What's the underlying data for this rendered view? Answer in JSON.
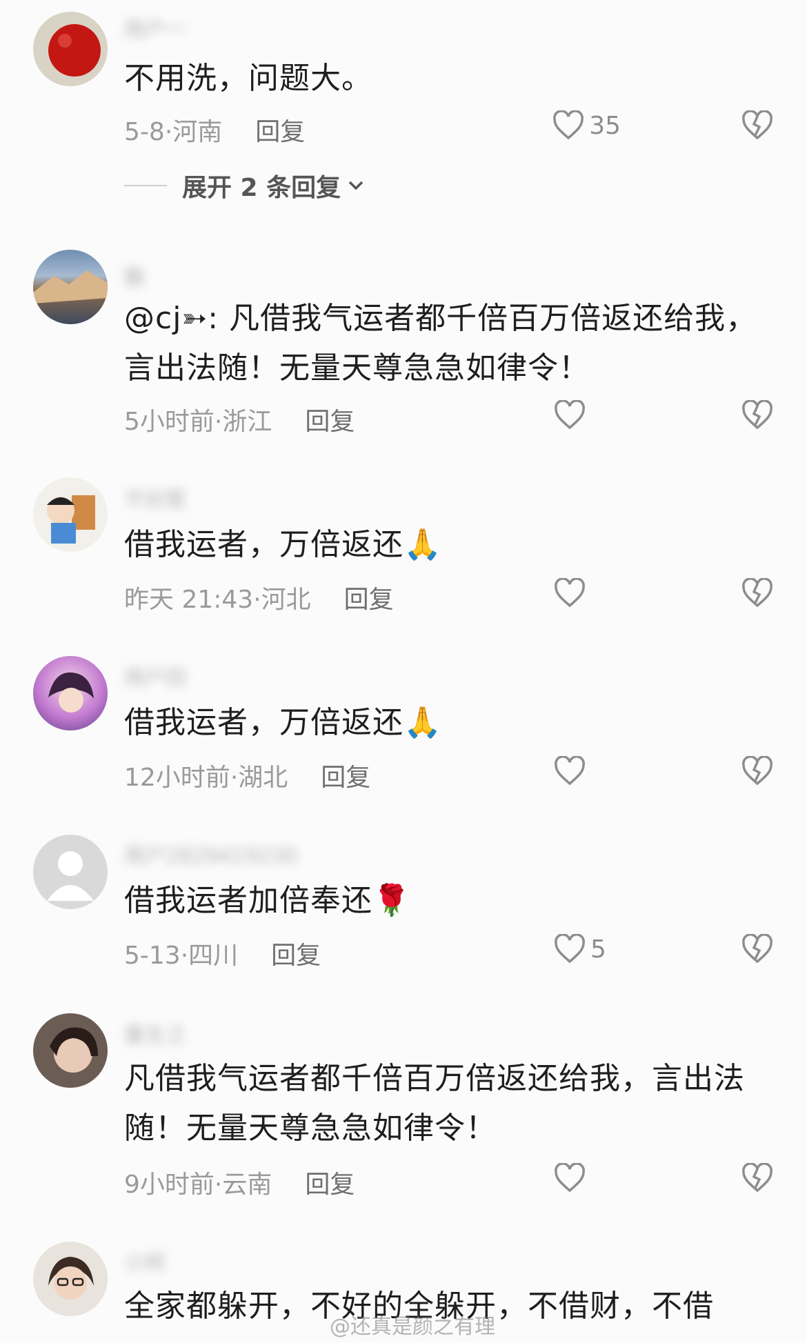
{
  "comments": [
    {
      "username": "用户一",
      "text": "不用洗，问题大。",
      "date": "5-8",
      "region": "河南",
      "reply": "回复",
      "likes": "35"
    },
    {
      "username": "飘",
      "text": "@cj➳: 凡借我气运者都千倍百万倍返还给我，言出法随！无量天尊急急如律令！",
      "date": "5小时前",
      "region": "浙江",
      "reply": "回复",
      "likes": ""
    },
    {
      "username": "不好惹",
      "text": "借我运者，万倍返还",
      "date": "昨天 21:43",
      "region": "河北",
      "reply": "回复",
      "likes": ""
    },
    {
      "username": "用户四",
      "text": "借我运者，万倍返还",
      "date": "12小时前",
      "region": "湖北",
      "reply": "回复",
      "likes": ""
    },
    {
      "username": "用户2829419230",
      "text": "借我运者加倍奉还",
      "date": "5-13",
      "region": "四川",
      "reply": "回复",
      "likes": "5"
    },
    {
      "username": "重生之",
      "text": "凡借我气运者都千倍百万倍返还给我，言出法随！无量天尊急急如律令！",
      "date": "9小时前",
      "region": "云南",
      "reply": "回复",
      "likes": ""
    },
    {
      "username": "小柯",
      "text": "全家都躲开，不好的全躲开，不借财，不借"
    }
  ],
  "expand_replies": "展开 2 条回复",
  "emoji_pray": "🙏",
  "emoji_rose": "🌹",
  "meta_separator": "·",
  "watermark": "@还真是颜之有理",
  "colors": {
    "background": "#fbfbfb",
    "text": "#1e1e1e",
    "meta": "#9a9a9a"
  }
}
